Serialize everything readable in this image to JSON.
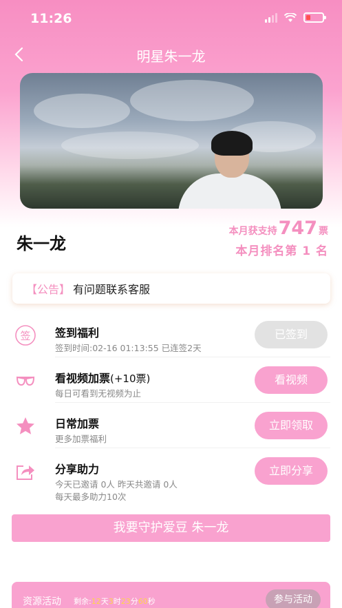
{
  "status_bar": {
    "time": "11:26"
  },
  "nav": {
    "back_icon": "chevron-left-icon",
    "title": "明星朱一龙"
  },
  "idol": {
    "name": "朱一龙",
    "support_prefix": "本月获支持",
    "support_count": "747",
    "support_suffix": "票",
    "rank_text": "本月排名第 1 名"
  },
  "notice": {
    "tag": "【公告】",
    "text": "有问题联系客服"
  },
  "tasks": [
    {
      "icon": "sign-in-icon",
      "title": "签到福利",
      "title_extra": "",
      "subtitle": "签到时间:02-16 01:13:55 已连签2天",
      "subtitle2": "",
      "button": "已签到",
      "disabled": true
    },
    {
      "icon": "glasses-icon",
      "title": "看视频加票",
      "title_extra": "(+10票)",
      "subtitle": "每日可看到无视频为止",
      "subtitle2": "",
      "button": "看视频",
      "disabled": false
    },
    {
      "icon": "star-icon",
      "title": "日常加票",
      "title_extra": "",
      "subtitle": "更多加票福利",
      "subtitle2": "",
      "button": "立即领取",
      "disabled": false
    },
    {
      "icon": "share-icon",
      "title": "分享助力",
      "title_extra": "",
      "subtitle": "今天已邀请 0人  昨天共邀请 0人",
      "subtitle2": "每天最多助力10次",
      "button": "立即分享",
      "disabled": false
    }
  ],
  "guard_button": "我要守护爱豆 朱一龙",
  "activity": {
    "label": "资源活动",
    "countdown_prefix": "剩余:",
    "days": "12",
    "days_unit": "天",
    "hours": "3",
    "hours_unit": "时",
    "minutes": "23",
    "minutes_unit": "分",
    "seconds": "60",
    "seconds_unit": "秒",
    "join_button": "参与活动"
  },
  "colors": {
    "accent": "#f48fbf",
    "button": "#f9a2cf",
    "disabled": "#e2e2e2",
    "countdown_number": "#ffd54a"
  }
}
